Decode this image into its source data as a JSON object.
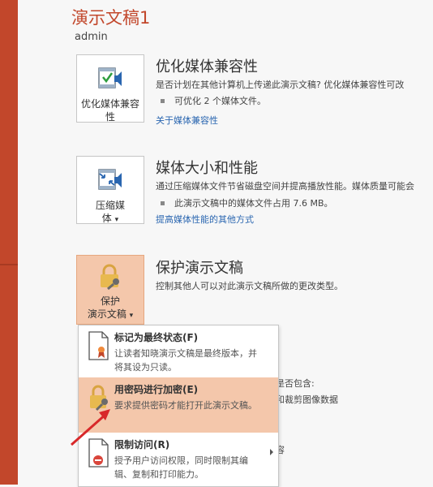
{
  "document": {
    "title": "演示文稿1",
    "author": "admin"
  },
  "sections": {
    "compat": {
      "button_label": "优化媒体兼容性",
      "title": "优化媒体兼容性",
      "description": "是否计划在其他计算机上传递此演示文稿? 优化媒体兼容性可改",
      "bullet": "可优化 2 个媒体文件。",
      "link": "关于媒体兼容性"
    },
    "size": {
      "button_label_1": "压缩媒",
      "button_label_2": "体",
      "button_caret": "▾",
      "title": "媒体大小和性能",
      "description": "通过压缩媒体文件节省磁盘空间并提高播放性能。媒体质量可能会",
      "bullet": "此演示文稿中的媒体文件占用 7.6 MB。",
      "link": "提高媒体性能的其他方式"
    },
    "protect": {
      "button_label_1": "保护",
      "button_label_2": "演示文稿",
      "button_caret": "▾",
      "title": "保护演示文稿",
      "description": "控制其他人可以对此演示文稿所做的更改类型。"
    }
  },
  "protect_menu": {
    "items": [
      {
        "title": "标记为最终状态(F)",
        "description": "让读者知晓演示文稿是最终版本，并将其设为只读。"
      },
      {
        "title": "用密码进行加密(E)",
        "description": "要求提供密码才能打开此演示文稿。"
      },
      {
        "title": "限制访问(R)",
        "description": "授予用户访问权限，同时限制其编辑、复制和打印能力。"
      }
    ]
  },
  "peek_text": {
    "line1": "意其是否包含:",
    "line2": "者名和裁剪图像数据",
    "line3": "的内容"
  },
  "colors": {
    "accent": "#c2472b",
    "highlight": "#f4c7ab",
    "link": "#2a66b0"
  }
}
